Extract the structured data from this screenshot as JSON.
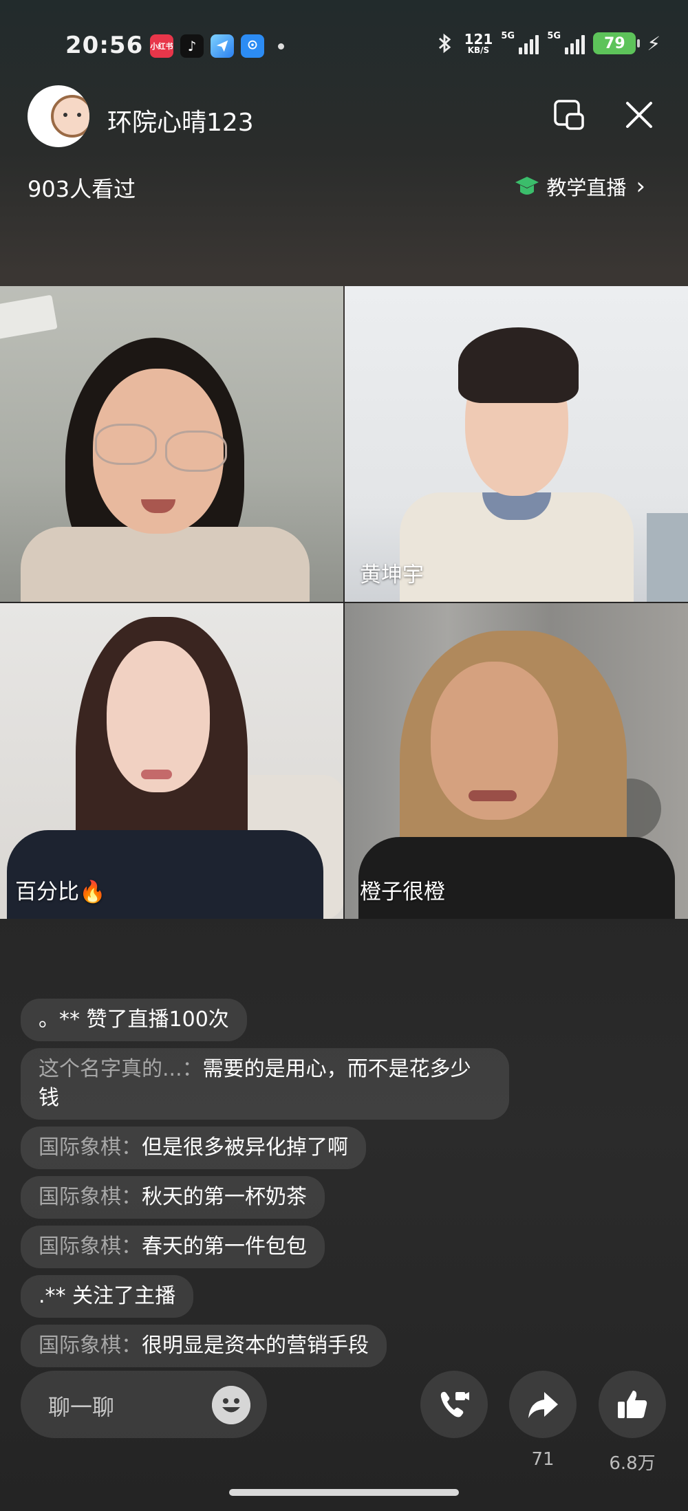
{
  "status_bar": {
    "time": "20:56",
    "network_speed_value": "121",
    "network_speed_unit": "KB/S",
    "signal1_label": "5G",
    "signal2_label": "5G",
    "battery": "79",
    "app_icons": [
      "xiaohongshu-icon",
      "douyin-icon",
      "telegram-icon",
      "traffic-icon"
    ]
  },
  "header": {
    "room_name": "环院心晴123",
    "viewers": "903人看过",
    "live_type": "教学直播",
    "live_type_arrow": "›"
  },
  "participants": [
    {
      "name": ""
    },
    {
      "name": "黄坤宇"
    },
    {
      "name": "百分比🔥"
    },
    {
      "name": "橙子很橙"
    }
  ],
  "chat": [
    {
      "user": "",
      "text": "。** 赞了直播100次"
    },
    {
      "user": "这个名字真的...：",
      "text": "需要的是用心，而不是花多少钱"
    },
    {
      "user": "国际象棋：",
      "text": "但是很多被异化掉了啊"
    },
    {
      "user": "国际象棋：",
      "text": "秋天的第一杯奶茶"
    },
    {
      "user": "国际象棋：",
      "text": "春天的第一件包包"
    },
    {
      "user": "",
      "text": ".** 关注了主播"
    },
    {
      "user": "国际象棋：",
      "text": "很明显是资本的营销手段"
    }
  ],
  "bottom": {
    "input_placeholder": "聊一聊",
    "share_count": "71",
    "like_count": "6.8万"
  },
  "colors": {
    "battery": "#5dc35a",
    "cap_icon": "#3bbd6b",
    "tag_bg": "rgba(255,255,255,0.1)"
  }
}
